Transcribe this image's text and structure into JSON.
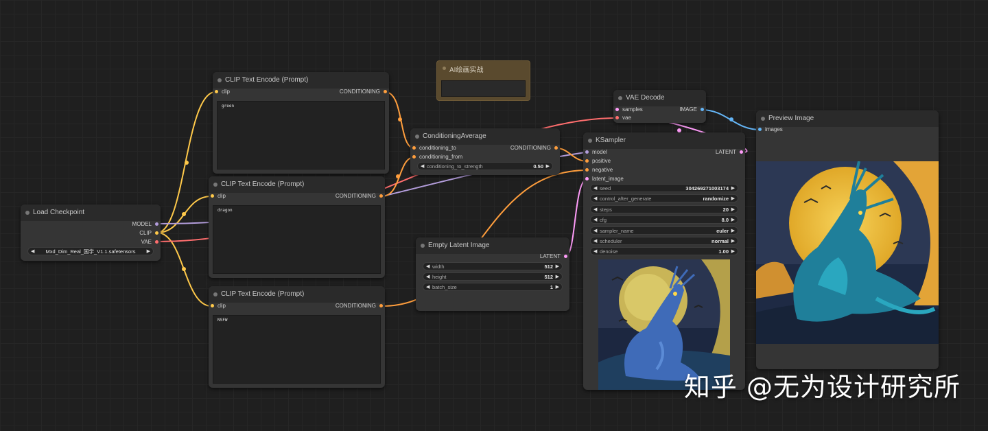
{
  "group": {
    "title": "AI绘画实战"
  },
  "load_checkpoint": {
    "title": "Load Checkpoint",
    "outputs": [
      "MODEL",
      "CLIP",
      "VAE"
    ],
    "ckpt_value": "Mxd_Dim_Real_国学_V1.1.safetensors"
  },
  "clip_top": {
    "title": "CLIP Text Encode (Prompt)",
    "input": "clip",
    "output": "CONDITIONING",
    "text": "green"
  },
  "clip_mid": {
    "title": "CLIP Text Encode (Prompt)",
    "input": "clip",
    "output": "CONDITIONING",
    "text": "dragon"
  },
  "clip_bot": {
    "title": "CLIP Text Encode (Prompt)",
    "input": "clip",
    "output": "CONDITIONING",
    "text": "NSFW"
  },
  "cond_avg": {
    "title": "ConditioningAverage",
    "inputs": [
      "conditioning_to",
      "conditioning_from"
    ],
    "output": "CONDITIONING",
    "widget": {
      "label": "conditioning_to_strength",
      "value": "0.50"
    }
  },
  "empty_latent": {
    "title": "Empty Latent Image",
    "output": "LATENT",
    "widgets": [
      {
        "label": "width",
        "value": "512"
      },
      {
        "label": "height",
        "value": "512"
      },
      {
        "label": "batch_size",
        "value": "1"
      }
    ]
  },
  "vae_decode": {
    "title": "VAE Decode",
    "inputs": [
      "samples",
      "vae"
    ],
    "output": "IMAGE"
  },
  "ksampler": {
    "title": "KSampler",
    "inputs": [
      "model",
      "positive",
      "negative",
      "latent_image"
    ],
    "output": "LATENT",
    "widgets": [
      {
        "label": "seed",
        "value": "304269271003174"
      },
      {
        "label": "control_after_generate",
        "value": "randomize"
      },
      {
        "label": "steps",
        "value": "20"
      },
      {
        "label": "cfg",
        "value": "8.0"
      },
      {
        "label": "sampler_name",
        "value": "euler"
      },
      {
        "label": "scheduler",
        "value": "normal"
      },
      {
        "label": "denoise",
        "value": "1.00"
      }
    ]
  },
  "preview": {
    "title": "Preview Image",
    "input": "images"
  },
  "watermark": "知乎 @无为设计研究所",
  "colors": {
    "clip_wire": "#ffc94a",
    "cond_wire": "#ff9e3d",
    "model_wire": "#b39ddb",
    "vae_wire": "#ff6e6e",
    "latent_wire": "#ff9cf9",
    "image_wire": "#64b5f6"
  }
}
